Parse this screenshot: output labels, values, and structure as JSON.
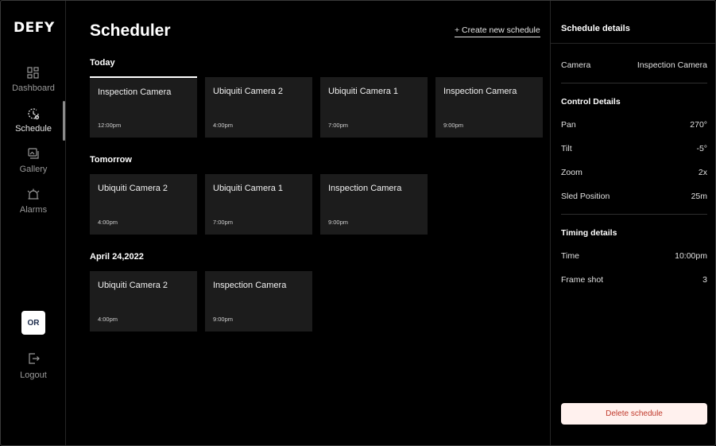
{
  "brand": {
    "logo_text": "DEFY"
  },
  "sidebar": {
    "items": [
      {
        "label": "Dashboard",
        "icon": "dashboard-grid-icon"
      },
      {
        "label": "Schedule",
        "icon": "schedule-clock-icon",
        "active": true
      },
      {
        "label": "Gallery",
        "icon": "gallery-icon"
      },
      {
        "label": "Alarms",
        "icon": "alarm-bell-icon"
      }
    ],
    "avatar_initials": "OR",
    "logout_label": "Logout"
  },
  "main": {
    "title": "Scheduler",
    "create_link": "+ Create new schedule",
    "sections": [
      {
        "label": "Today",
        "cards": [
          {
            "name": "Inspection Camera",
            "time": "12:00pm",
            "selected": true
          },
          {
            "name": "Ubiquiti Camera 2",
            "time": "4:00pm"
          },
          {
            "name": "Ubiquiti Camera 1",
            "time": "7:00pm"
          },
          {
            "name": "Inspection Camera",
            "time": "9:00pm"
          }
        ]
      },
      {
        "label": "Tomorrow",
        "cards": [
          {
            "name": "Ubiquiti Camera 2",
            "time": "4:00pm"
          },
          {
            "name": "Ubiquiti Camera 1",
            "time": "7:00pm"
          },
          {
            "name": "Inspection Camera",
            "time": "9:00pm"
          }
        ]
      },
      {
        "label": "April 24,2022",
        "cards": [
          {
            "name": "Ubiquiti Camera 2",
            "time": "4:00pm"
          },
          {
            "name": "Inspection Camera",
            "time": "9:00pm"
          }
        ]
      }
    ]
  },
  "details": {
    "title": "Schedule details",
    "camera_label": "Camera",
    "camera_value": "Inspection Camera",
    "control_title": "Control Details",
    "control_rows": [
      {
        "label": "Pan",
        "value": "270°"
      },
      {
        "label": "Tilt",
        "value": "-5°"
      },
      {
        "label": "Zoom",
        "value": "2x"
      },
      {
        "label": "Sled Position",
        "value": "25m"
      }
    ],
    "timing_title": "Timing details",
    "timing_rows": [
      {
        "label": "Time",
        "value": "10:00pm"
      },
      {
        "label": "Frame shot",
        "value": "3"
      }
    ],
    "delete_label": "Delete schedule"
  },
  "colors": {
    "background": "#000000",
    "card": "#1c1c1c",
    "delete_bg": "#fff1ee",
    "delete_text": "#c0392b"
  }
}
